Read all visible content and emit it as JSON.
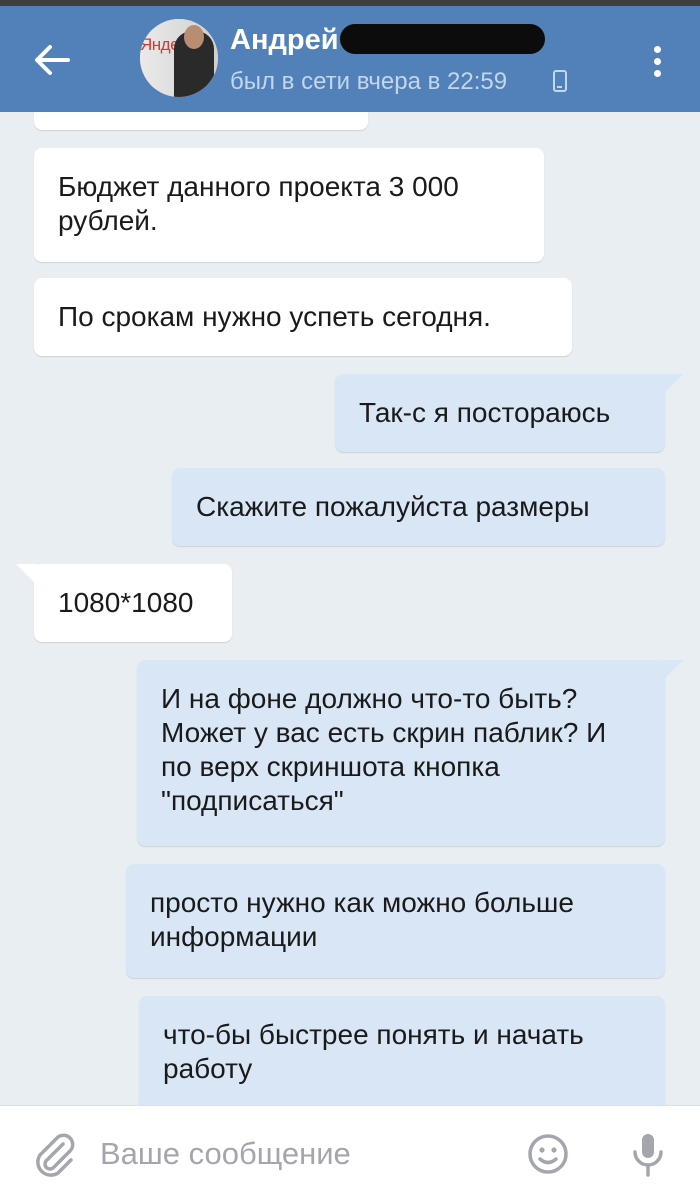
{
  "header": {
    "contact_name": "Андрей",
    "last_seen": "был в сети вчера в 22:59",
    "avatar_logo_text": "Яндек"
  },
  "messages": [
    {
      "direction": "incoming",
      "text": ""
    },
    {
      "direction": "incoming",
      "text": "Бюджет данного проекта 3 000 рублей."
    },
    {
      "direction": "incoming",
      "text": "По срокам нужно успеть сегодня."
    },
    {
      "direction": "outgoing",
      "text": "Так-с я постораюсь"
    },
    {
      "direction": "outgoing",
      "text": "Скажите пожалуйста размеры"
    },
    {
      "direction": "incoming",
      "text": "1080*1080"
    },
    {
      "direction": "outgoing",
      "text": "И на фоне должно что-то быть? Может у вас есть скрин паблик? И по верх скриншота кнопка \"подписаться\""
    },
    {
      "direction": "outgoing",
      "text": "просто нужно как можно больше информации"
    },
    {
      "direction": "outgoing",
      "text": "что-бы быстрее понять и начать работу"
    }
  ],
  "composer": {
    "placeholder": "Ваше сообщение"
  },
  "icons": {
    "back": "arrow-left-icon",
    "menu": "more-vertical-icon",
    "online_device": "phone-icon",
    "attach": "paperclip-icon",
    "emoji": "smiley-icon",
    "mic": "microphone-icon"
  },
  "colors": {
    "header_bg": "#5181b8",
    "chat_bg": "#e9eef3",
    "incoming_bubble": "#ffffff",
    "outgoing_bubble": "#d9e6f5",
    "icon_gray": "#a3a7ad"
  }
}
